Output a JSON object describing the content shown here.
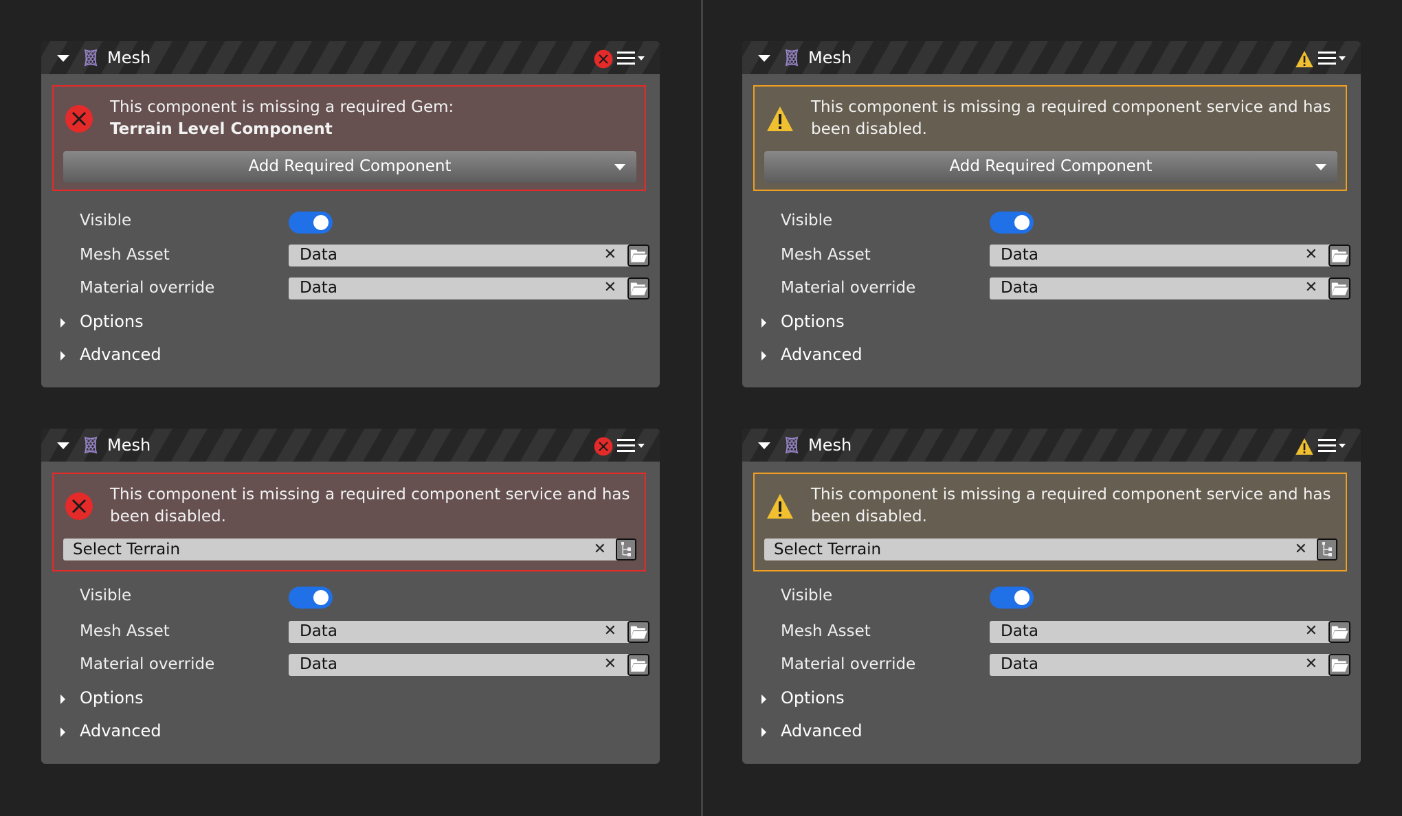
{
  "colors": {
    "error": "#e52a2a",
    "warning": "#f0c030",
    "toggle_on": "#2070e8",
    "mesh_icon": "#9a86cc"
  },
  "panels": [
    {
      "title": "Mesh",
      "status": "error",
      "status_icon": "error-x-icon",
      "message_line1": "This component is missing a required Gem:",
      "message_line2": "Terrain Level Component",
      "action_button": "Add Required Component",
      "properties": {
        "visible_label": "Visible",
        "visible_on": true,
        "mesh_asset_label": "Mesh Asset",
        "mesh_asset_value": "Data",
        "material_override_label": "Material override",
        "material_override_value": "Data",
        "options_label": "Options",
        "advanced_label": "Advanced"
      }
    },
    {
      "title": "Mesh",
      "status": "warning",
      "status_icon": "warning-triangle-icon",
      "message_line1": "This component is missing a required component service and has been disabled.",
      "action_button": "Add Required Component",
      "properties": {
        "visible_label": "Visible",
        "visible_on": true,
        "mesh_asset_label": "Mesh Asset",
        "mesh_asset_value": "Data",
        "material_override_label": "Material override",
        "material_override_value": "Data",
        "options_label": "Options",
        "advanced_label": "Advanced"
      }
    },
    {
      "title": "Mesh",
      "status": "error",
      "status_icon": "error-x-icon",
      "message_line1": "This component is missing a required component service and has been disabled.",
      "select_field": "Select Terrain",
      "properties": {
        "visible_label": "Visible",
        "visible_on": true,
        "mesh_asset_label": "Mesh Asset",
        "mesh_asset_value": "Data",
        "material_override_label": "Material override",
        "material_override_value": "Data",
        "options_label": "Options",
        "advanced_label": "Advanced"
      }
    },
    {
      "title": "Mesh",
      "status": "warning",
      "status_icon": "warning-triangle-icon",
      "message_line1": "This component is missing a required component service and has been disabled.",
      "select_field": "Select Terrain",
      "properties": {
        "visible_label": "Visible",
        "visible_on": true,
        "mesh_asset_label": "Mesh Asset",
        "mesh_asset_value": "Data",
        "material_override_label": "Material override",
        "material_override_value": "Data",
        "options_label": "Options",
        "advanced_label": "Advanced"
      }
    }
  ],
  "glyphs": {
    "clear": "✕"
  }
}
